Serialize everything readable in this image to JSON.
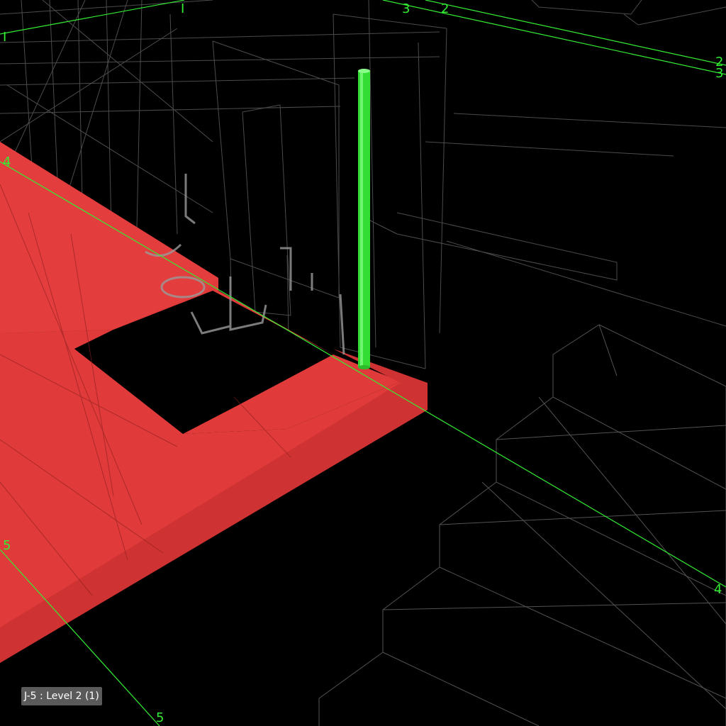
{
  "viewport": {
    "background_color": "#000000",
    "wireframe_color": "#8a8a8a"
  },
  "grid": {
    "line_color": "#33ee33",
    "labels": {
      "a_left": "I",
      "a_top": "I",
      "b_top": "2",
      "b_right": "2",
      "c_top": "3",
      "c_right": "3",
      "d_left": "4",
      "d_right": "4",
      "e_left": "5",
      "e_bottom": "5"
    }
  },
  "slab": {
    "name": "floor slab",
    "fill_color": "#e03a3a",
    "edge_color": "#b82a2a"
  },
  "column": {
    "name": "selected column",
    "color": "#33dd33",
    "highlight_color": "#8aff8a"
  },
  "selection": {
    "label": "J-5 : Level 2 (1)"
  }
}
